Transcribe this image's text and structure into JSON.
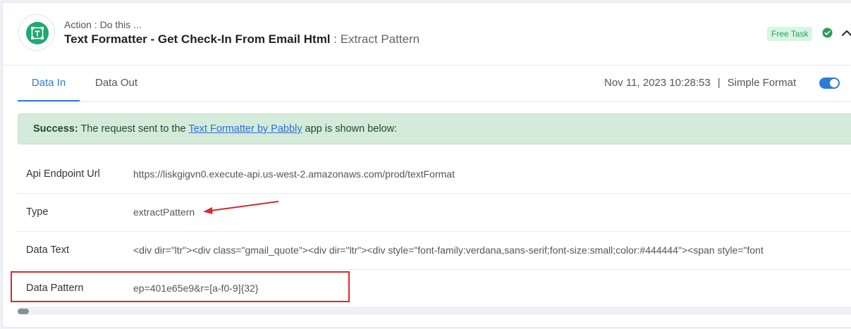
{
  "header": {
    "action_label": "Action : Do this ...",
    "title": "Text Formatter - Get Check-In From Email Html",
    "title_separator": " : ",
    "step_name": "Extract Pattern",
    "badge": "Free Task",
    "icons": {
      "app_logo": "text-formatter-logo",
      "status": "check-circle-icon",
      "collapse": "chevron-up-icon"
    },
    "colors": {
      "logo_green": "#1fa872",
      "status_green": "#2a9d5c"
    }
  },
  "tabs": [
    {
      "label": "Data In",
      "active": true
    },
    {
      "label": "Data Out",
      "active": false
    }
  ],
  "meta": {
    "timestamp": "Nov 11, 2023 10:28:53",
    "separator": "|",
    "format_label": "Simple Format",
    "format_toggle_on": true
  },
  "success": {
    "strong": "Success:",
    "prefix": " The request sent to the ",
    "link": "Text Formatter by Pabbly",
    "suffix": " app is shown below:"
  },
  "rows": [
    {
      "key": "Api Endpoint Url",
      "value": "https://liskgigvn0.execute-api.us-west-2.amazonaws.com/prod/textFormat"
    },
    {
      "key": "Type",
      "value": "extractPattern"
    },
    {
      "key": "Data Text",
      "value": "<div dir=\"ltr\"><div class=\"gmail_quote\"><div dir=\"ltr\"><div style=\"font-family:verdana,sans-serif;font-size:small;color:#444444\"><span style=\"font"
    },
    {
      "key": "Data Pattern",
      "value": "ep=401e65e9&r=[a-f0-9]{32}"
    }
  ],
  "annotation_color": "#d42b2b",
  "accent_color": "#2f7ad6"
}
